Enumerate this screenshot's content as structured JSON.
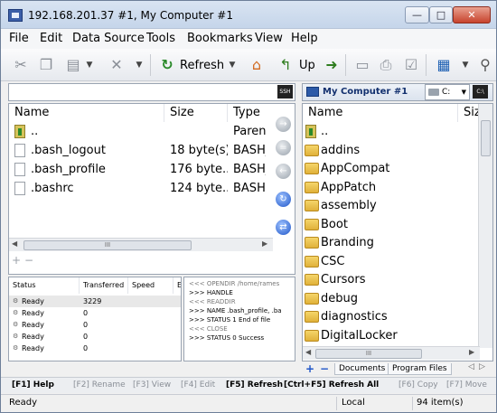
{
  "window": {
    "title": "192.168.201.37 #1, My Computer #1",
    "controls": {
      "minimize": "—",
      "maximize": "□",
      "close": "✕"
    }
  },
  "menu": [
    "File",
    "Edit",
    "Data Source",
    "Tools",
    "Bookmarks",
    "View",
    "Help"
  ],
  "toolbar": {
    "refresh_label": "Refresh",
    "up_label": "Up",
    "icons": [
      "cut-icon",
      "copy-icon",
      "paste-icon",
      "delete-icon",
      "refresh-icon",
      "home-icon",
      "up-icon",
      "go-icon",
      "new-icon",
      "print-icon",
      "properties-icon",
      "view-icon",
      "search-icon"
    ]
  },
  "left_panel": {
    "ssh_button": "SSH",
    "columns": [
      "Name",
      "Size",
      "Type"
    ],
    "rows": [
      {
        "name": "..",
        "size": "",
        "type": "Parent",
        "icon": "up-dir-icon"
      },
      {
        "name": ".bash_logout",
        "size": "18 byte(s)",
        "type": "BASH_I",
        "icon": "file-icon"
      },
      {
        "name": ".bash_profile",
        "size": "176 byte...",
        "type": "BASH_I",
        "icon": "file-icon"
      },
      {
        "name": ".bashrc",
        "size": "124 byte...",
        "type": "BASHR",
        "icon": "file-icon"
      }
    ],
    "scroll_thumb": "III",
    "plus": "+",
    "minus": "−"
  },
  "middle_buttons": [
    "→",
    "=",
    "←",
    "↻",
    "⇄"
  ],
  "right_panel": {
    "title": "My Computer #1",
    "drive": "C:",
    "cmd_button": "C:\\",
    "columns": [
      "Name",
      "Siz"
    ],
    "rows": [
      {
        "name": "..",
        "icon": "up-dir-icon"
      },
      {
        "name": "addins",
        "icon": "folder-icon"
      },
      {
        "name": "AppCompat",
        "icon": "folder-icon"
      },
      {
        "name": "AppPatch",
        "icon": "folder-icon"
      },
      {
        "name": "assembly",
        "icon": "folder-icon"
      },
      {
        "name": "Boot",
        "icon": "folder-icon"
      },
      {
        "name": "Branding",
        "icon": "folder-icon"
      },
      {
        "name": "CSC",
        "icon": "folder-icon"
      },
      {
        "name": "Cursors",
        "icon": "folder-icon"
      },
      {
        "name": "debug",
        "icon": "folder-icon"
      },
      {
        "name": "diagnostics",
        "icon": "folder-icon"
      },
      {
        "name": "DigitalLocker",
        "icon": "folder-icon"
      }
    ],
    "scroll_thumb": "III",
    "bookmark_tabs": [
      "Documents",
      "Program Files"
    ],
    "plus": "+",
    "minus": "−",
    "nav": [
      "◁",
      "▷"
    ]
  },
  "queue": {
    "columns": [
      "Status",
      "Transferred",
      "Speed",
      "E"
    ],
    "rows": [
      {
        "status": "Ready",
        "transferred": "3229"
      },
      {
        "status": "Ready",
        "transferred": "0"
      },
      {
        "status": "Ready",
        "transferred": "0"
      },
      {
        "status": "Ready",
        "transferred": "0"
      },
      {
        "status": "Ready",
        "transferred": "0"
      }
    ]
  },
  "log": [
    {
      "text": "<<< OPENDIR /home/rames",
      "dir": "in"
    },
    {
      "text": ">>> HANDLE",
      "dir": "out"
    },
    {
      "text": "<<< READDIR",
      "dir": "in"
    },
    {
      "text": ">>> NAME .bash_profile, .ba",
      "dir": "out"
    },
    {
      "text": ">>> STATUS 1 End of file",
      "dir": "out"
    },
    {
      "text": "<<< CLOSE",
      "dir": "in"
    },
    {
      "text": ">>> STATUS 0 Success",
      "dir": "out"
    }
  ],
  "fkeys": [
    {
      "label": "[F1] Help",
      "enabled": true
    },
    {
      "label": "[F2] Rename",
      "enabled": false
    },
    {
      "label": "[F3] View",
      "enabled": false
    },
    {
      "label": "[F4] Edit",
      "enabled": false
    },
    {
      "label": "[F5] Refresh",
      "enabled": true
    },
    {
      "label": "[Ctrl+F5] Refresh All",
      "enabled": true
    },
    {
      "label": "[F6] Copy",
      "enabled": false
    },
    {
      "label": "[F7] Move",
      "enabled": false
    }
  ],
  "status": {
    "left": "Ready",
    "location": "Local",
    "count": "94 item(s)"
  }
}
